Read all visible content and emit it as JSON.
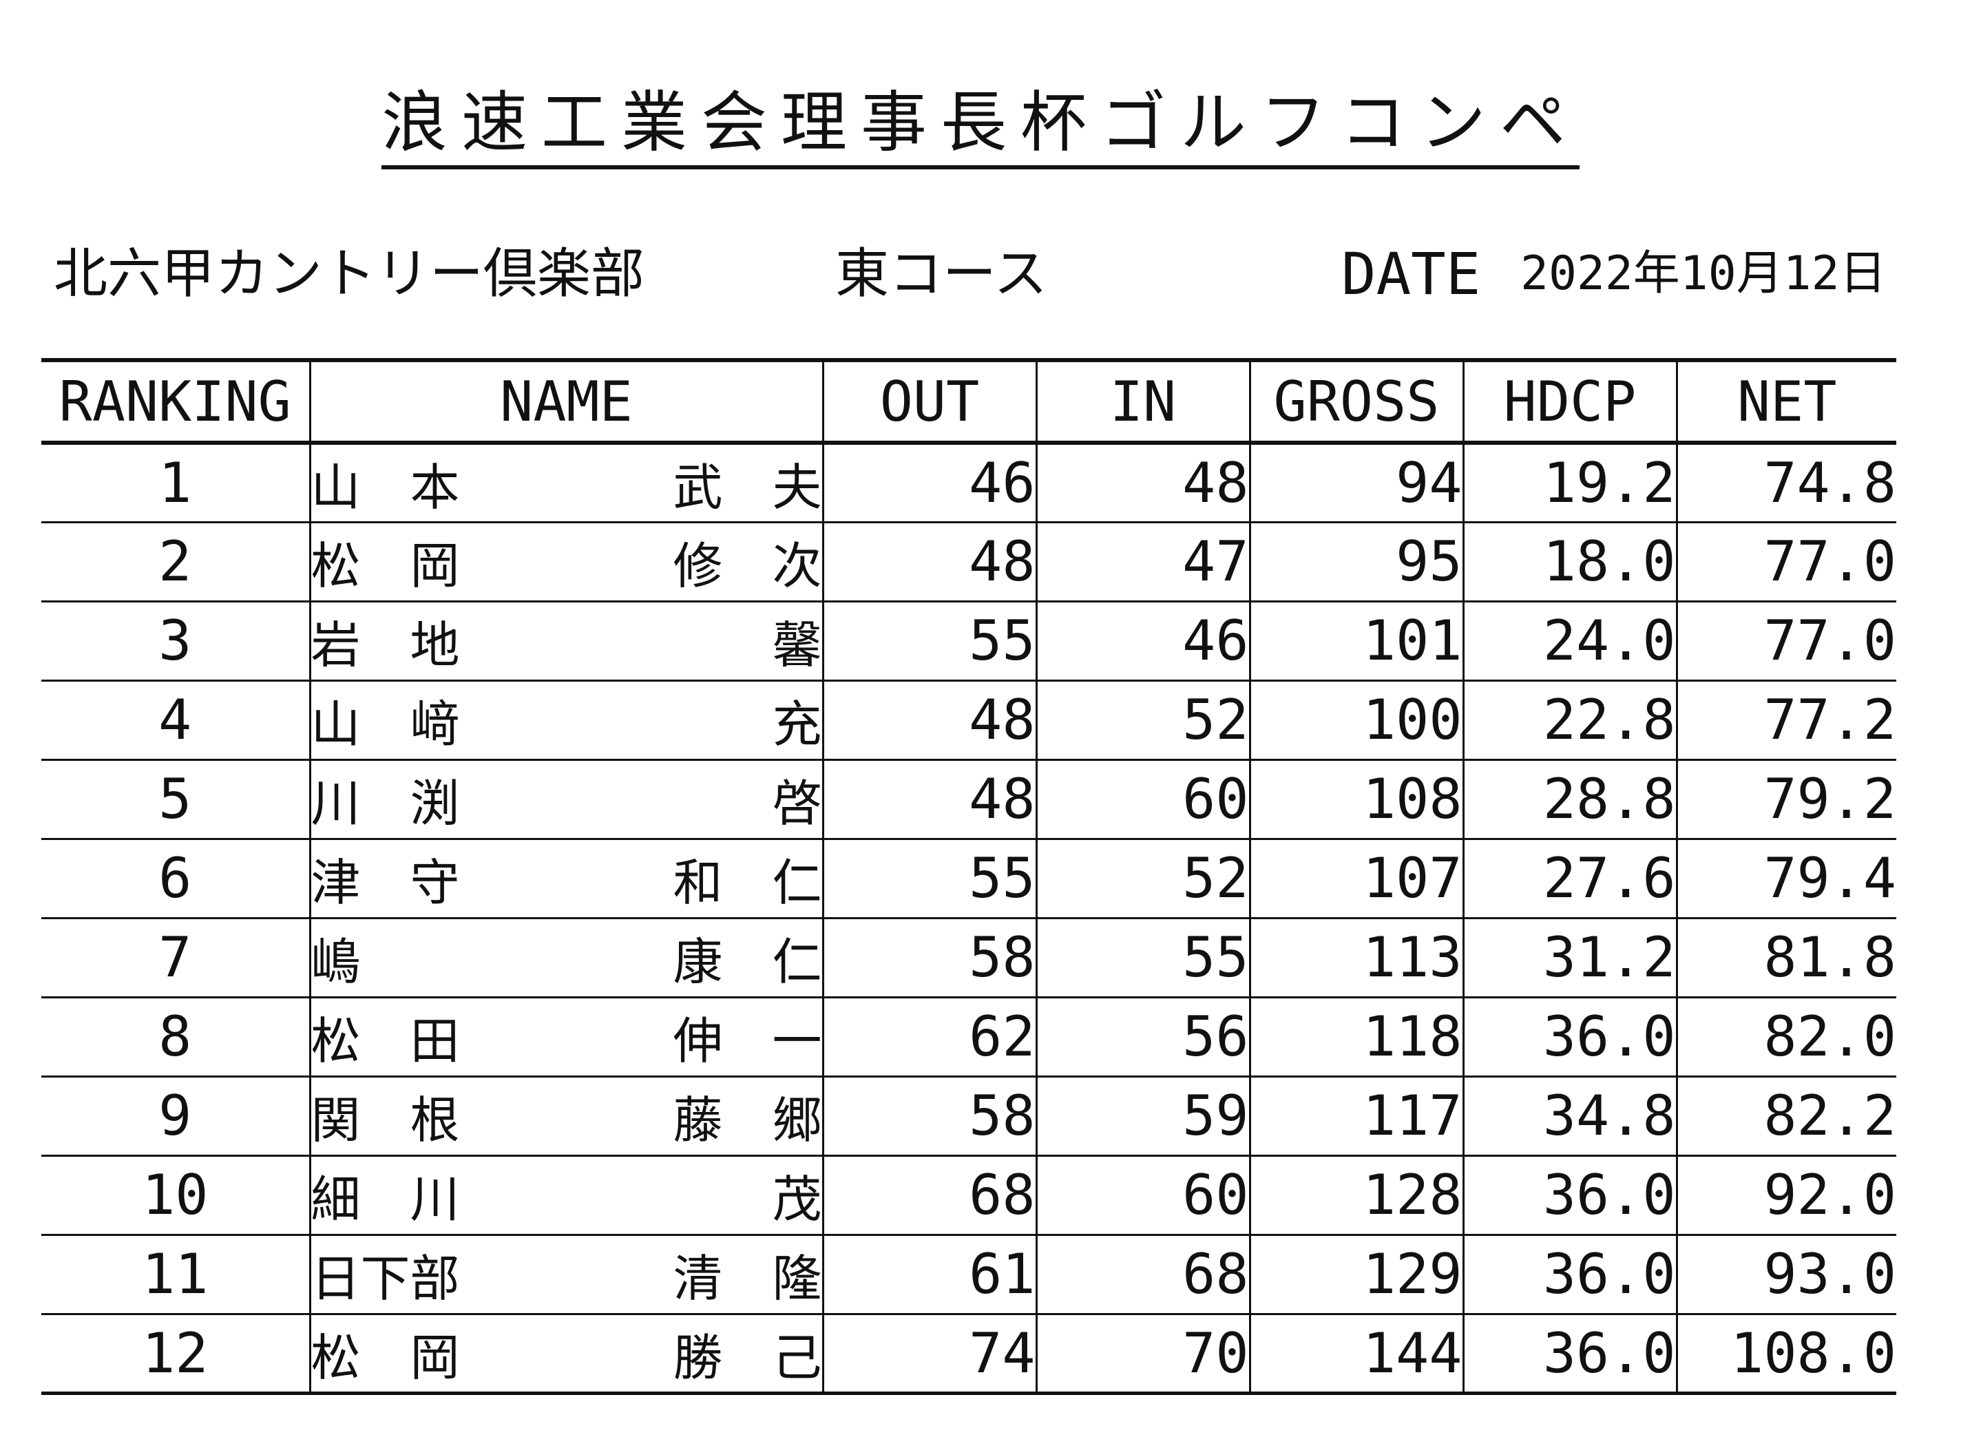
{
  "header": {
    "title": "浪速工業会理事長杯ゴルフコンペ",
    "venue": "北六甲カントリー倶楽部",
    "course": "東コース",
    "date_label": "DATE",
    "date_value": "2022年10月12日"
  },
  "table": {
    "columns": [
      "RANKING",
      "NAME",
      "OUT",
      "IN",
      "GROSS",
      "HDCP",
      "NET"
    ],
    "rows": [
      {
        "rank": "1",
        "family": "山　本",
        "given": "武　夫",
        "out": "46",
        "in": "48",
        "gross": "94",
        "hdcp": "19.2",
        "net": "74.8"
      },
      {
        "rank": "2",
        "family": "松　岡",
        "given": "修　次",
        "out": "48",
        "in": "47",
        "gross": "95",
        "hdcp": "18.0",
        "net": "77.0"
      },
      {
        "rank": "3",
        "family": "岩　地",
        "given": "馨",
        "out": "55",
        "in": "46",
        "gross": "101",
        "hdcp": "24.0",
        "net": "77.0"
      },
      {
        "rank": "4",
        "family": "山　﨑",
        "given": "充",
        "out": "48",
        "in": "52",
        "gross": "100",
        "hdcp": "22.8",
        "net": "77.2"
      },
      {
        "rank": "5",
        "family": "川　渕",
        "given": "啓",
        "out": "48",
        "in": "60",
        "gross": "108",
        "hdcp": "28.8",
        "net": "79.2"
      },
      {
        "rank": "6",
        "family": "津　守",
        "given": "和　仁",
        "out": "55",
        "in": "52",
        "gross": "107",
        "hdcp": "27.6",
        "net": "79.4"
      },
      {
        "rank": "7",
        "family": "嶋",
        "given": "康　仁",
        "out": "58",
        "in": "55",
        "gross": "113",
        "hdcp": "31.2",
        "net": "81.8"
      },
      {
        "rank": "8",
        "family": "松　田",
        "given": "伸　一",
        "out": "62",
        "in": "56",
        "gross": "118",
        "hdcp": "36.0",
        "net": "82.0"
      },
      {
        "rank": "9",
        "family": "関　根",
        "given": "藤　郷",
        "out": "58",
        "in": "59",
        "gross": "117",
        "hdcp": "34.8",
        "net": "82.2"
      },
      {
        "rank": "10",
        "family": "細　川",
        "given": "茂",
        "out": "68",
        "in": "60",
        "gross": "128",
        "hdcp": "36.0",
        "net": "92.0"
      },
      {
        "rank": "11",
        "family": "日下部",
        "given": "清　隆",
        "out": "61",
        "in": "68",
        "gross": "129",
        "hdcp": "36.0",
        "net": "93.0"
      },
      {
        "rank": "12",
        "family": "松　岡",
        "given": "勝　己",
        "out": "74",
        "in": "70",
        "gross": "144",
        "hdcp": "36.0",
        "net": "108.0"
      }
    ]
  }
}
